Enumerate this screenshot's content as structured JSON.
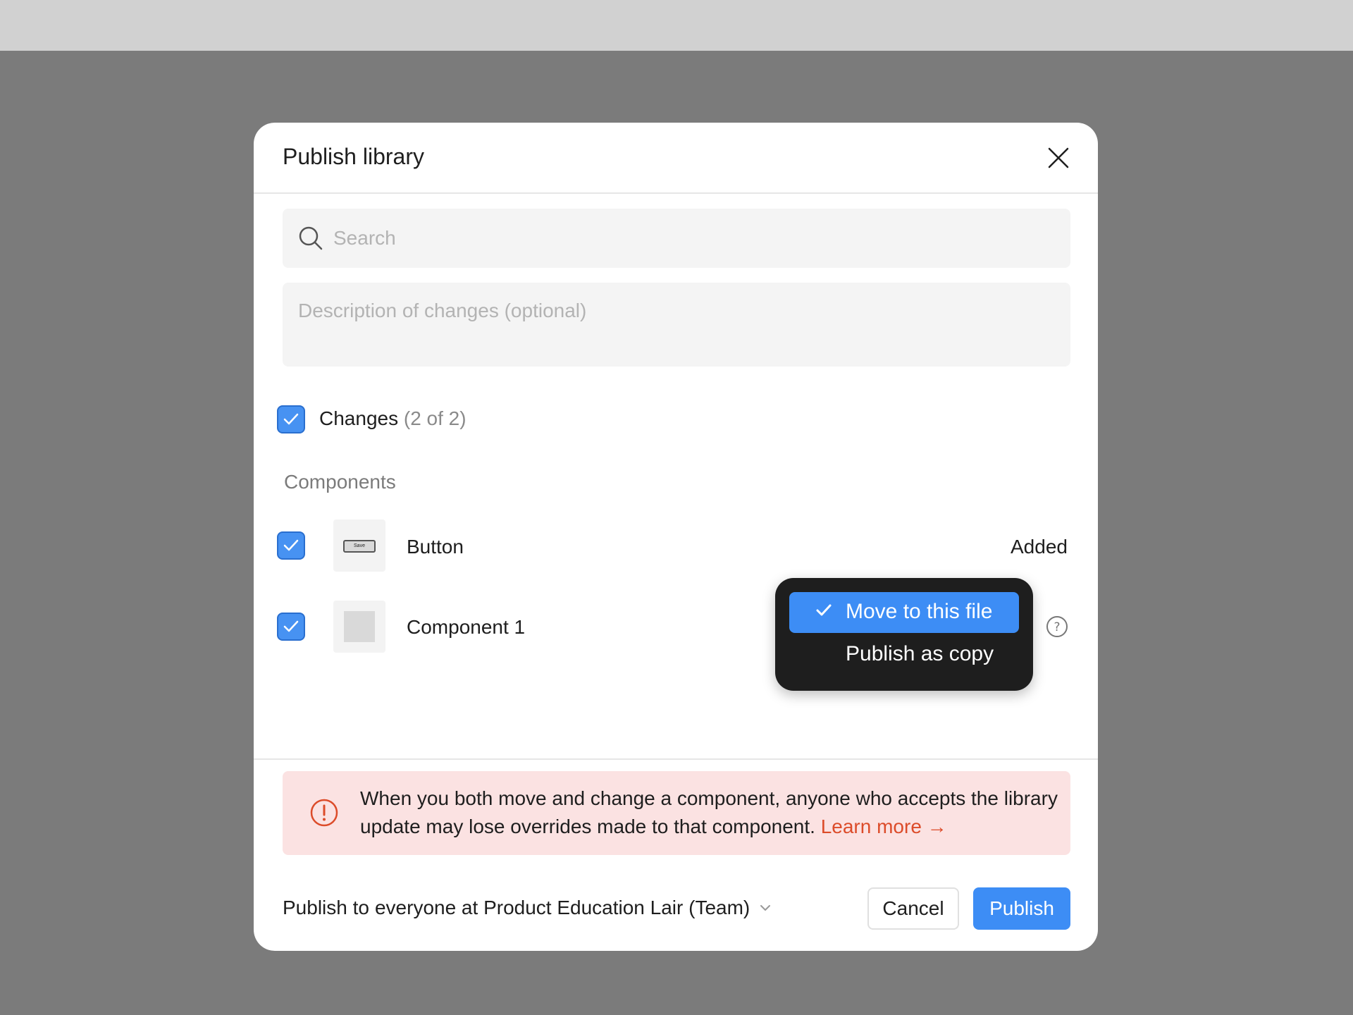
{
  "dialog": {
    "title": "Publish library",
    "close_icon": "close-icon"
  },
  "search": {
    "placeholder": "Search",
    "value": "",
    "icon": "search-icon"
  },
  "description": {
    "placeholder": "Description of changes (optional)",
    "value": ""
  },
  "changes": {
    "label": "Changes",
    "count": "(2 of 2)",
    "checked": true
  },
  "components": {
    "section_label": "Components",
    "items": [
      {
        "name": "Button",
        "status": "Added",
        "checked": true,
        "thumb_text": "Save"
      },
      {
        "name": "Component 1",
        "checked": true
      }
    ]
  },
  "move_menu": {
    "options": [
      {
        "label": "Move to this file",
        "selected": true
      },
      {
        "label": "Publish as copy",
        "selected": false
      }
    ]
  },
  "warning": {
    "text": "When you both move and change a component, anyone who accepts the library update may lose overrides made to that component.",
    "link": "Learn more →"
  },
  "footer": {
    "publish_to_label": "Publish to",
    "publish_to_target": "everyone at Product Education Lair (Team)",
    "cancel_label": "Cancel",
    "publish_label": "Publish"
  },
  "colors": {
    "accent": "#3d8df5",
    "warning_bg": "#fbe2e2",
    "warning_accent": "#dc4c2a",
    "menu_bg": "#1e1e1e",
    "overlay": "#7b7b7b"
  }
}
